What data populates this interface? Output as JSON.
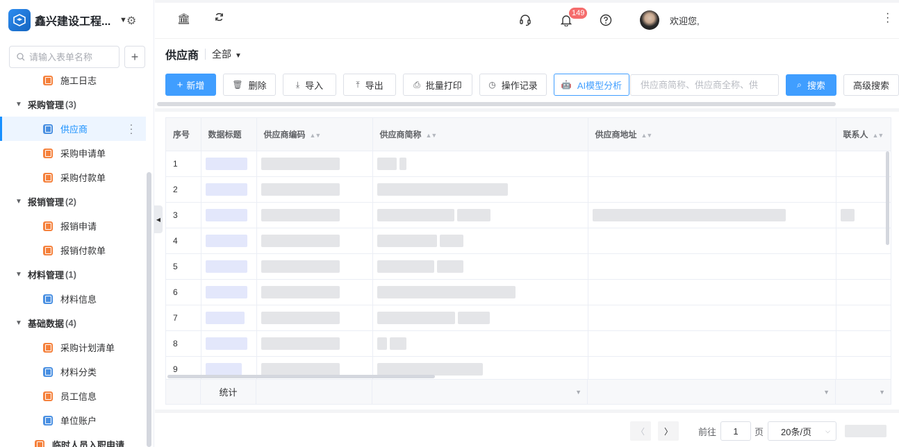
{
  "app": {
    "name": "鑫兴建设工程..."
  },
  "sidebar": {
    "search_placeholder": "请输入表单名称",
    "add_label": "+",
    "items": [
      {
        "type": "leaf",
        "label": "施工日志",
        "icon": "orange-form-icon"
      },
      {
        "type": "group",
        "label": "采购管理",
        "count": "(3)"
      },
      {
        "type": "leaf",
        "label": "供应商",
        "icon": "blue-form-icon",
        "active": true
      },
      {
        "type": "leaf",
        "label": "采购申请单",
        "icon": "orange-form-icon"
      },
      {
        "type": "leaf",
        "label": "采购付款单",
        "icon": "orange-form-icon"
      },
      {
        "type": "group",
        "label": "报销管理",
        "count": "(2)"
      },
      {
        "type": "leaf",
        "label": "报销申请",
        "icon": "orange-form-icon"
      },
      {
        "type": "leaf",
        "label": "报销付款单",
        "icon": "orange-form-icon"
      },
      {
        "type": "group",
        "label": "材料管理",
        "count": "(1)"
      },
      {
        "type": "leaf",
        "label": "材料信息",
        "icon": "blue-form-icon"
      },
      {
        "type": "group",
        "label": "基础数据",
        "count": "(4)"
      },
      {
        "type": "leaf",
        "label": "采购计划清单",
        "icon": "orange-form-icon"
      },
      {
        "type": "leaf",
        "label": "材料分类",
        "icon": "blue-form-icon"
      },
      {
        "type": "leaf",
        "label": "员工信息",
        "icon": "orange-form-icon"
      },
      {
        "type": "leaf",
        "label": "单位账户",
        "icon": "blue-form-icon"
      },
      {
        "type": "leaf-top",
        "label": "临时人员入职申请",
        "icon": "orange-form-icon"
      }
    ]
  },
  "topbar": {
    "notification_count": "149",
    "welcome": "欢迎您,"
  },
  "page": {
    "title": "供应商",
    "filter": "全部"
  },
  "toolbar": {
    "new": "新增",
    "delete": "删除",
    "import": "导入",
    "export": "导出",
    "batch_print": "批量打印",
    "op_log": "操作记录",
    "ai": "AI模型分析",
    "search_placeholder": "供应商简称、供应商全称、供",
    "search": "搜索",
    "advanced": "高级搜索"
  },
  "table": {
    "columns": [
      "序号",
      "数据标题",
      "供应商编码",
      "供应商简称",
      "供应商地址",
      "联系人"
    ],
    "row_numbers": [
      "1",
      "2",
      "3",
      "4",
      "5",
      "6",
      "7",
      "8",
      "9"
    ],
    "stat_label": "统计"
  },
  "pager": {
    "goto": "前往",
    "page": "1",
    "page_unit": "页",
    "page_size": "20条/页"
  },
  "colors": {
    "primary": "#409eff",
    "active_bg": "#edf5ff",
    "badge": "#f56c6c",
    "orange_icon": "#f5813c",
    "blue_icon": "#4a90e2"
  }
}
